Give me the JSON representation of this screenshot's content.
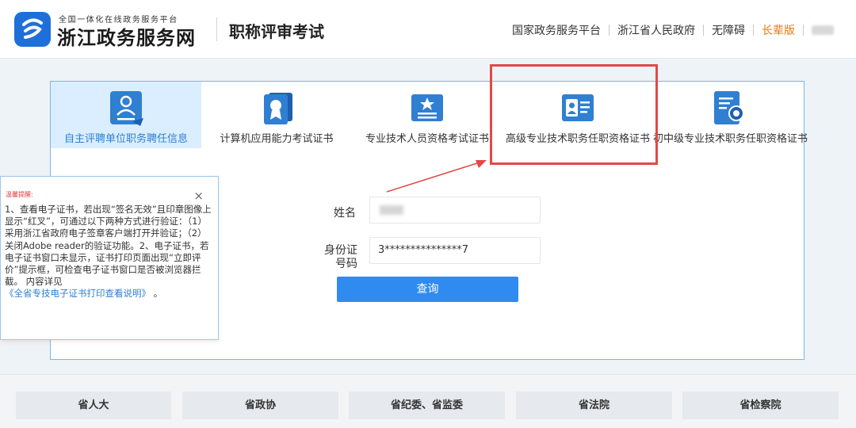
{
  "header": {
    "logo_sub": "全国一体化在线政务服务平台",
    "logo_main": "浙江政务服务网",
    "site_title": "职称评审考试",
    "links": [
      "国家政务服务平台",
      "浙江省人民政府",
      "无障碍",
      "长辈版"
    ],
    "accent_color": "#e87a17"
  },
  "tabs": [
    {
      "label": "自主评聘单位职务聘任信息",
      "icon": "person-doc-icon",
      "active": true
    },
    {
      "label": "计算机应用能力考试证书",
      "icon": "certificate-stack-icon",
      "active": false
    },
    {
      "label": "专业技术人员资格考试证书",
      "icon": "star-card-icon",
      "active": false
    },
    {
      "label": "高级专业技术职务任职资格证书",
      "icon": "id-card-icon",
      "active": false
    },
    {
      "label": "初中级专业技术职务任职资格证书",
      "icon": "document-seal-icon",
      "active": false
    }
  ],
  "form": {
    "name_label": "姓名",
    "id_label": "身份证号码",
    "id_value": "3***************7",
    "submit_label": "查询"
  },
  "tip": {
    "title": "温馨提醒:",
    "body": "1、查看电子证书，若出现“签名无效”且印章图像上显示“红叉”，可通过以下两种方式进行验证：（1）采用浙江省政府电子签章客户端打开并验证；（2）关闭Adobe reader的验证功能。2、电子证书，若电子证书窗口未显示，证书打印页面出现“立即评价”提示框，可检查电子证书窗口是否被浏览器拦截。 内容详见",
    "link": "《全省专技电子证书打印查看说明》",
    "end": "。",
    "close": "×"
  },
  "footer": [
    "省人大",
    "省政协",
    "省纪委、省监委",
    "省法院",
    "省检察院"
  ],
  "colors": {
    "primary": "#2f8bf0",
    "highlight": "#e34848",
    "tab_active_bg": "#dbeeff"
  }
}
